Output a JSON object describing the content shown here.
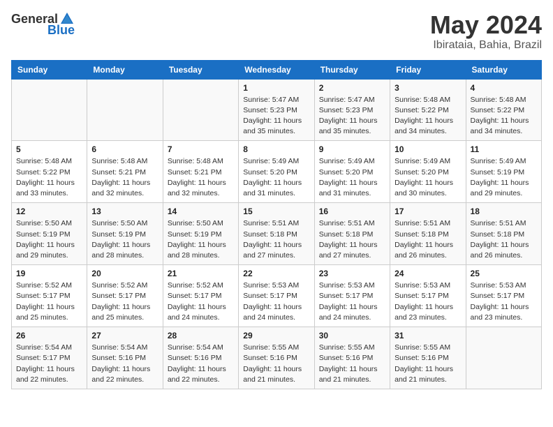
{
  "logo": {
    "general": "General",
    "blue": "Blue"
  },
  "header": {
    "month": "May 2024",
    "location": "Ibirataia, Bahia, Brazil"
  },
  "weekdays": [
    "Sunday",
    "Monday",
    "Tuesday",
    "Wednesday",
    "Thursday",
    "Friday",
    "Saturday"
  ],
  "weeks": [
    [
      {
        "day": "",
        "sunrise": "",
        "sunset": "",
        "daylight": ""
      },
      {
        "day": "",
        "sunrise": "",
        "sunset": "",
        "daylight": ""
      },
      {
        "day": "",
        "sunrise": "",
        "sunset": "",
        "daylight": ""
      },
      {
        "day": "1",
        "sunrise": "Sunrise: 5:47 AM",
        "sunset": "Sunset: 5:23 PM",
        "daylight": "Daylight: 11 hours and 35 minutes."
      },
      {
        "day": "2",
        "sunrise": "Sunrise: 5:47 AM",
        "sunset": "Sunset: 5:23 PM",
        "daylight": "Daylight: 11 hours and 35 minutes."
      },
      {
        "day": "3",
        "sunrise": "Sunrise: 5:48 AM",
        "sunset": "Sunset: 5:22 PM",
        "daylight": "Daylight: 11 hours and 34 minutes."
      },
      {
        "day": "4",
        "sunrise": "Sunrise: 5:48 AM",
        "sunset": "Sunset: 5:22 PM",
        "daylight": "Daylight: 11 hours and 34 minutes."
      }
    ],
    [
      {
        "day": "5",
        "sunrise": "Sunrise: 5:48 AM",
        "sunset": "Sunset: 5:22 PM",
        "daylight": "Daylight: 11 hours and 33 minutes."
      },
      {
        "day": "6",
        "sunrise": "Sunrise: 5:48 AM",
        "sunset": "Sunset: 5:21 PM",
        "daylight": "Daylight: 11 hours and 32 minutes."
      },
      {
        "day": "7",
        "sunrise": "Sunrise: 5:48 AM",
        "sunset": "Sunset: 5:21 PM",
        "daylight": "Daylight: 11 hours and 32 minutes."
      },
      {
        "day": "8",
        "sunrise": "Sunrise: 5:49 AM",
        "sunset": "Sunset: 5:20 PM",
        "daylight": "Daylight: 11 hours and 31 minutes."
      },
      {
        "day": "9",
        "sunrise": "Sunrise: 5:49 AM",
        "sunset": "Sunset: 5:20 PM",
        "daylight": "Daylight: 11 hours and 31 minutes."
      },
      {
        "day": "10",
        "sunrise": "Sunrise: 5:49 AM",
        "sunset": "Sunset: 5:20 PM",
        "daylight": "Daylight: 11 hours and 30 minutes."
      },
      {
        "day": "11",
        "sunrise": "Sunrise: 5:49 AM",
        "sunset": "Sunset: 5:19 PM",
        "daylight": "Daylight: 11 hours and 29 minutes."
      }
    ],
    [
      {
        "day": "12",
        "sunrise": "Sunrise: 5:50 AM",
        "sunset": "Sunset: 5:19 PM",
        "daylight": "Daylight: 11 hours and 29 minutes."
      },
      {
        "day": "13",
        "sunrise": "Sunrise: 5:50 AM",
        "sunset": "Sunset: 5:19 PM",
        "daylight": "Daylight: 11 hours and 28 minutes."
      },
      {
        "day": "14",
        "sunrise": "Sunrise: 5:50 AM",
        "sunset": "Sunset: 5:19 PM",
        "daylight": "Daylight: 11 hours and 28 minutes."
      },
      {
        "day": "15",
        "sunrise": "Sunrise: 5:51 AM",
        "sunset": "Sunset: 5:18 PM",
        "daylight": "Daylight: 11 hours and 27 minutes."
      },
      {
        "day": "16",
        "sunrise": "Sunrise: 5:51 AM",
        "sunset": "Sunset: 5:18 PM",
        "daylight": "Daylight: 11 hours and 27 minutes."
      },
      {
        "day": "17",
        "sunrise": "Sunrise: 5:51 AM",
        "sunset": "Sunset: 5:18 PM",
        "daylight": "Daylight: 11 hours and 26 minutes."
      },
      {
        "day": "18",
        "sunrise": "Sunrise: 5:51 AM",
        "sunset": "Sunset: 5:18 PM",
        "daylight": "Daylight: 11 hours and 26 minutes."
      }
    ],
    [
      {
        "day": "19",
        "sunrise": "Sunrise: 5:52 AM",
        "sunset": "Sunset: 5:17 PM",
        "daylight": "Daylight: 11 hours and 25 minutes."
      },
      {
        "day": "20",
        "sunrise": "Sunrise: 5:52 AM",
        "sunset": "Sunset: 5:17 PM",
        "daylight": "Daylight: 11 hours and 25 minutes."
      },
      {
        "day": "21",
        "sunrise": "Sunrise: 5:52 AM",
        "sunset": "Sunset: 5:17 PM",
        "daylight": "Daylight: 11 hours and 24 minutes."
      },
      {
        "day": "22",
        "sunrise": "Sunrise: 5:53 AM",
        "sunset": "Sunset: 5:17 PM",
        "daylight": "Daylight: 11 hours and 24 minutes."
      },
      {
        "day": "23",
        "sunrise": "Sunrise: 5:53 AM",
        "sunset": "Sunset: 5:17 PM",
        "daylight": "Daylight: 11 hours and 24 minutes."
      },
      {
        "day": "24",
        "sunrise": "Sunrise: 5:53 AM",
        "sunset": "Sunset: 5:17 PM",
        "daylight": "Daylight: 11 hours and 23 minutes."
      },
      {
        "day": "25",
        "sunrise": "Sunrise: 5:53 AM",
        "sunset": "Sunset: 5:17 PM",
        "daylight": "Daylight: 11 hours and 23 minutes."
      }
    ],
    [
      {
        "day": "26",
        "sunrise": "Sunrise: 5:54 AM",
        "sunset": "Sunset: 5:17 PM",
        "daylight": "Daylight: 11 hours and 22 minutes."
      },
      {
        "day": "27",
        "sunrise": "Sunrise: 5:54 AM",
        "sunset": "Sunset: 5:16 PM",
        "daylight": "Daylight: 11 hours and 22 minutes."
      },
      {
        "day": "28",
        "sunrise": "Sunrise: 5:54 AM",
        "sunset": "Sunset: 5:16 PM",
        "daylight": "Daylight: 11 hours and 22 minutes."
      },
      {
        "day": "29",
        "sunrise": "Sunrise: 5:55 AM",
        "sunset": "Sunset: 5:16 PM",
        "daylight": "Daylight: 11 hours and 21 minutes."
      },
      {
        "day": "30",
        "sunrise": "Sunrise: 5:55 AM",
        "sunset": "Sunset: 5:16 PM",
        "daylight": "Daylight: 11 hours and 21 minutes."
      },
      {
        "day": "31",
        "sunrise": "Sunrise: 5:55 AM",
        "sunset": "Sunset: 5:16 PM",
        "daylight": "Daylight: 11 hours and 21 minutes."
      },
      {
        "day": "",
        "sunrise": "",
        "sunset": "",
        "daylight": ""
      }
    ]
  ]
}
